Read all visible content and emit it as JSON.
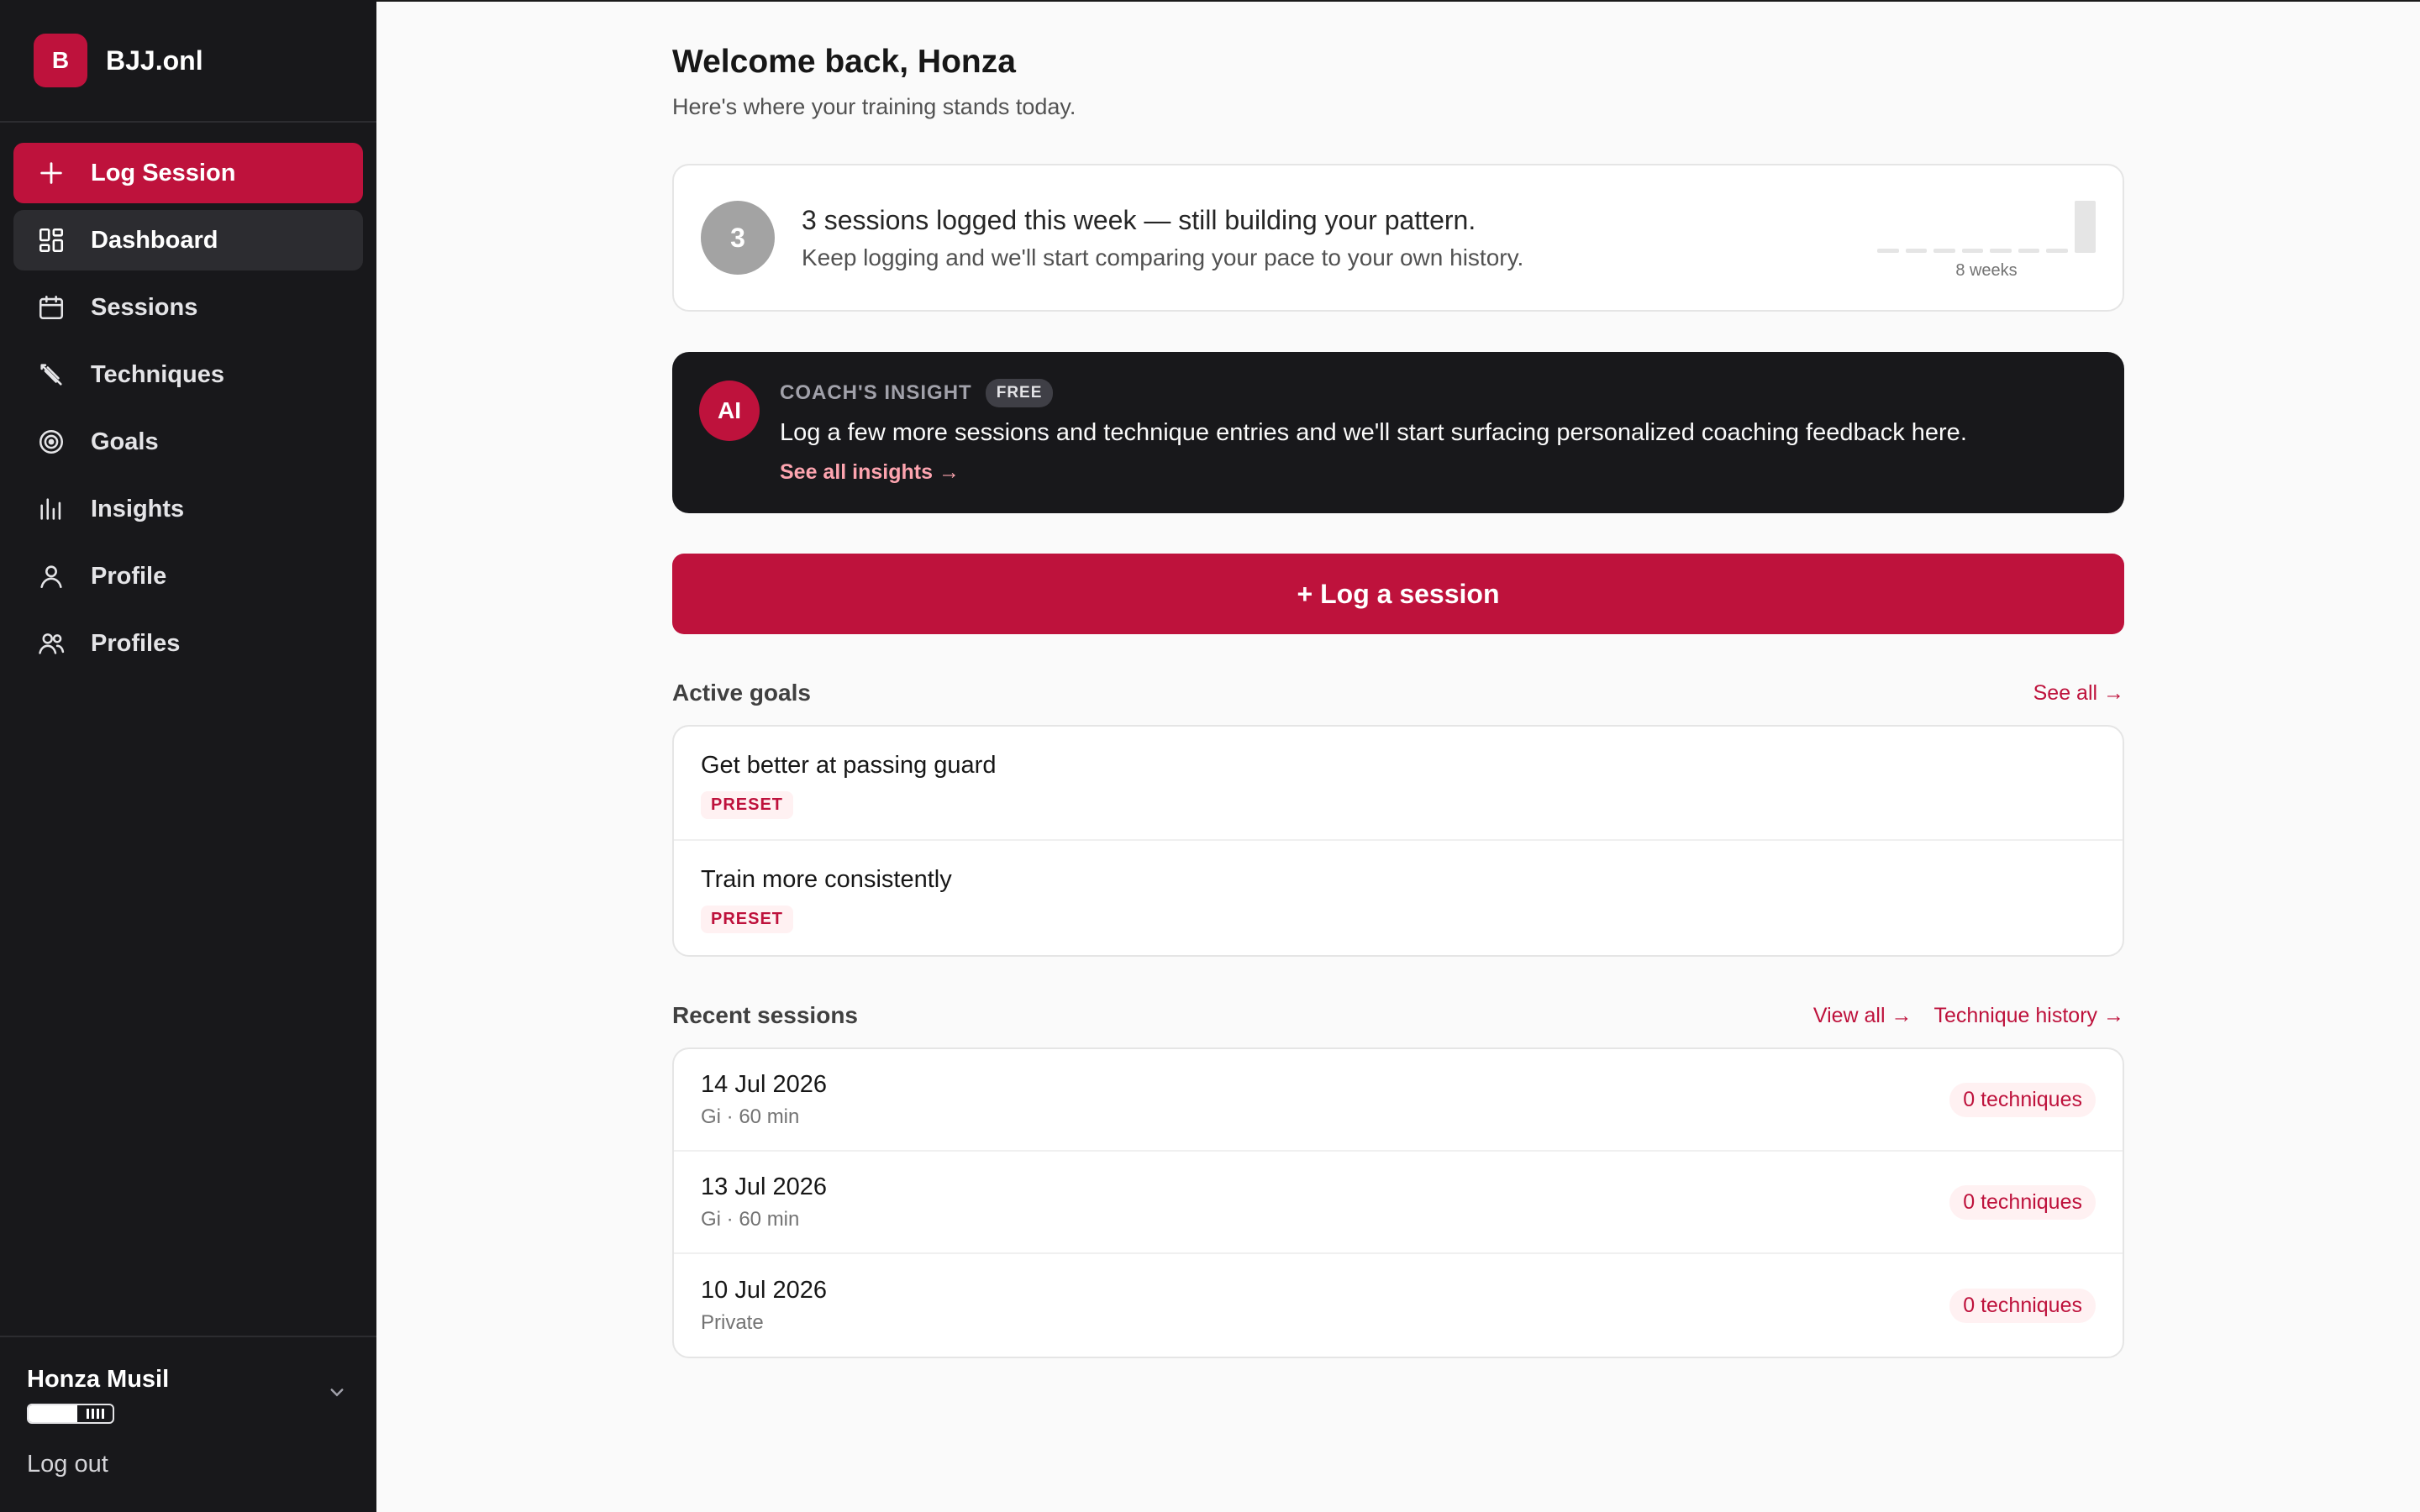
{
  "brand": {
    "mark": "B",
    "name": "BJJ.onl"
  },
  "nav": [
    {
      "label": "Log Session",
      "icon": "plus-icon"
    },
    {
      "label": "Dashboard",
      "icon": "dashboard-icon"
    },
    {
      "label": "Sessions",
      "icon": "calendar-icon"
    },
    {
      "label": "Techniques",
      "icon": "pencil-icon"
    },
    {
      "label": "Goals",
      "icon": "target-icon"
    },
    {
      "label": "Insights",
      "icon": "bar-chart-icon"
    },
    {
      "label": "Profile",
      "icon": "user-icon"
    },
    {
      "label": "Profiles",
      "icon": "users-icon"
    }
  ],
  "user": {
    "name": "Honza Musil",
    "logout": "Log out"
  },
  "welcome": {
    "title": "Welcome back, Honza",
    "subtitle": "Here's where your training stands today."
  },
  "pattern": {
    "count": "3",
    "title": "3 sessions logged this week — still building your pattern.",
    "subtitle": "Keep logging and we'll start comparing your pace to your own history.",
    "spark_label": "8 weeks",
    "weekly_sessions": [
      0,
      0,
      0,
      0,
      0,
      0,
      0,
      3
    ]
  },
  "insight": {
    "badge": "AI",
    "label": "COACH'S INSIGHT",
    "pill": "FREE",
    "text": "Log a few more sessions and technique entries and we'll start surfacing personalized coaching feedback here.",
    "link": "See all insights →"
  },
  "log_button": "+ Log a session",
  "goals": {
    "title": "Active goals",
    "see_all": "See all →",
    "items": [
      {
        "title": "Get better at passing guard",
        "tag": "PRESET"
      },
      {
        "title": "Train more consistently",
        "tag": "PRESET"
      }
    ]
  },
  "sessions": {
    "title": "Recent sessions",
    "view_all": "View all →",
    "history": "Technique history →",
    "items": [
      {
        "date": "14 Jul 2026",
        "meta": "Gi · 60 min",
        "techniques": "0 techniques"
      },
      {
        "date": "13 Jul 2026",
        "meta": "Gi · 60 min",
        "techniques": "0 techniques"
      },
      {
        "date": "10 Jul 2026",
        "meta": "Private",
        "techniques": "0 techniques"
      }
    ]
  },
  "colors": {
    "accent": "#be123c",
    "sidebar": "#18181b",
    "background": "#fafafa"
  }
}
